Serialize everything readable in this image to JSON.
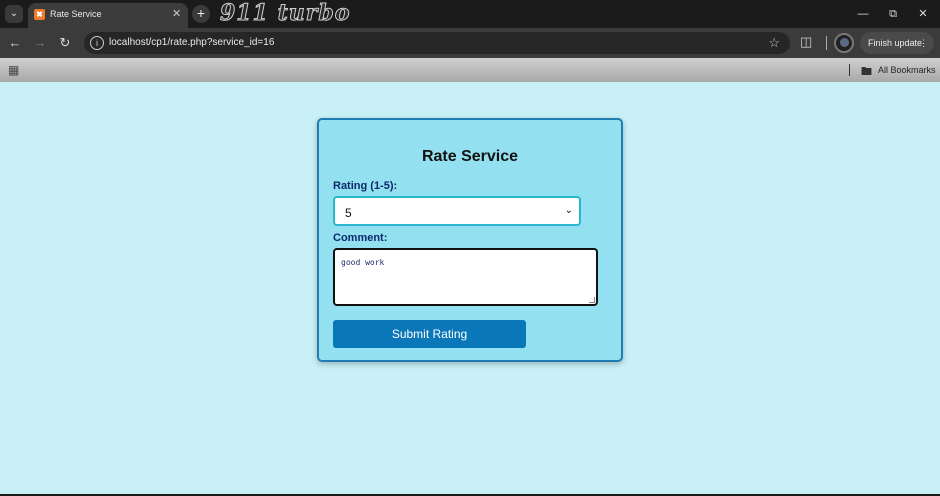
{
  "browser": {
    "tab_title": "Rate Service",
    "brand_text": "911 turbo",
    "url": "localhost/cp1/rate.php?service_id=16",
    "finish_update_label": "Finish update",
    "bookmarks_label": "All Bookmarks"
  },
  "icons": {
    "tab_search": "chevron-down-icon",
    "favicon": "xampp-icon",
    "close": "close-icon",
    "new_tab": "plus-icon",
    "back": "arrow-left-icon",
    "forward": "arrow-right-icon",
    "reload": "reload-icon",
    "info": "info-icon",
    "star": "star-icon",
    "extensions": "puzzle-icon",
    "profile": "avatar",
    "apps": "apps-grid-icon",
    "folder": "folder-icon"
  },
  "form": {
    "title": "Rate Service",
    "rating_label": "Rating (1-5):",
    "rating_value": "5",
    "comment_label": "Comment:",
    "comment_value": "good work",
    "submit_label": "Submit Rating"
  },
  "colors": {
    "page_bg": "#c9eff7",
    "card_bg": "#93e0f0",
    "card_border": "#1f7db4",
    "button_bg": "#0a78b8",
    "label_color": "#0b2a6b"
  }
}
